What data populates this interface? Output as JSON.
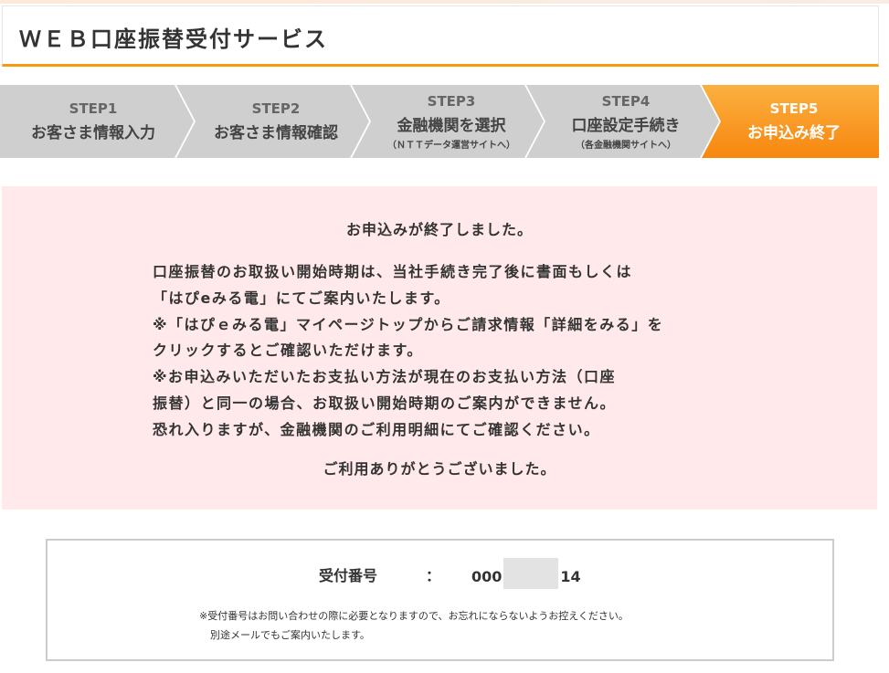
{
  "header": {
    "title": "ＷＥＢ口座振替受付サービス"
  },
  "steps": [
    {
      "label": "STEP1",
      "main": "お客さま情報入力",
      "sub": ""
    },
    {
      "label": "STEP2",
      "main": "お客さま情報確認",
      "sub": ""
    },
    {
      "label": "STEP3",
      "main": "金融機関を選択",
      "sub": "（ＮＴＴデータ運営サイトへ）"
    },
    {
      "label": "STEP4",
      "main": "口座設定手続き",
      "sub": "（各金融機関サイトへ）"
    },
    {
      "label": "STEP5",
      "main": "お申込み終了",
      "sub": ""
    }
  ],
  "colors": {
    "step_inactive": "#cfcfcf",
    "step_active": "#f7931e",
    "header_border": "#f39c12",
    "message_bg": "#ffe9ea"
  },
  "message": {
    "title": "お申込みが終了しました。",
    "lines": [
      "口座振替のお取扱い開始時期は、当社手続き完了後に書面もしくは",
      "「はぴeみる電」にてご案内いたします。",
      "※「はぴｅみる電」マイページトップからご請求情報「詳細をみる」を",
      "クリックするとご確認いただけます。",
      "※お申込みいただいたお支払い方法が現在のお支払い方法（口座",
      "振替）と同一の場合、お取扱い開始時期のご案内ができません。",
      "恐れ入りますが、金融機関のご利用明細にてご確認ください。"
    ],
    "thanks": "ご利用ありがとうございました。"
  },
  "receipt": {
    "label": "受付番号",
    "colon": "：",
    "number_prefix": "000",
    "number_suffix": "14",
    "note_line1": "※受付番号はお問い合わせの際に必要となりますので、お忘れにならないようお控えください。",
    "note_line2": "別途メールでもご案内いたします。"
  }
}
